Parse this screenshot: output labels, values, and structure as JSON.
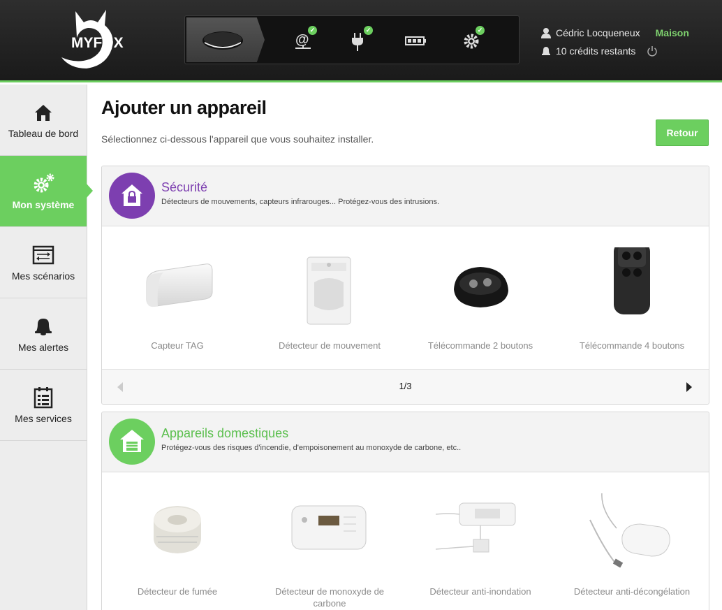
{
  "brand": {
    "logo_text": "MYFOX",
    "accent": "#6ccf5f"
  },
  "header": {
    "user_name": "Cédric Locqueneux",
    "home_name": "Maison",
    "credits": "10 crédits restants",
    "devices": [
      {
        "icon": "hub-device-icon",
        "status": "selected"
      },
      {
        "icon": "internet-icon",
        "status": "ok"
      },
      {
        "icon": "power-plug-icon",
        "status": "ok"
      },
      {
        "icon": "battery-icon",
        "status": "none"
      },
      {
        "icon": "gear-icon",
        "status": "ok"
      }
    ]
  },
  "sidebar": {
    "items": [
      {
        "label": "Tableau de bord",
        "icon": "home-icon",
        "active": false
      },
      {
        "label": "Mon système",
        "icon": "gears-icon",
        "active": true
      },
      {
        "label": "Mes scénarios",
        "icon": "scenarios-icon",
        "active": false
      },
      {
        "label": "Mes alertes",
        "icon": "bell-icon",
        "active": false
      },
      {
        "label": "Mes services",
        "icon": "services-icon",
        "active": false
      }
    ]
  },
  "page": {
    "title": "Ajouter un appareil",
    "subtitle": "Sélectionnez ci-dessous l'appareil que vous souhaitez installer.",
    "back_button": "Retour"
  },
  "categories": [
    {
      "title": "Sécurité",
      "description": "Détecteurs de mouvements, capteurs infrarouges... Protégez-vous des intrusions.",
      "color": "#7d3fb0",
      "icon": "lock-house-icon",
      "devices": [
        {
          "label": "Capteur TAG"
        },
        {
          "label": "Détecteur de mouvement"
        },
        {
          "label": "Télécommande 2 boutons"
        },
        {
          "label": "Télécommande 4 boutons"
        }
      ],
      "pagination": "1/3"
    },
    {
      "title": "Appareils domestiques",
      "description": "Protégez-vous des risques d'incendie, d'empoisonement au monoxyde de carbone, etc..",
      "color": "#6ccf5f",
      "icon": "garage-house-icon",
      "devices": [
        {
          "label": "Détecteur de fumée"
        },
        {
          "label": "Détecteur de monoxyde de carbone"
        },
        {
          "label": "Détecteur anti-inondation"
        },
        {
          "label": "Détecteur anti-décongélation"
        }
      ]
    }
  ]
}
